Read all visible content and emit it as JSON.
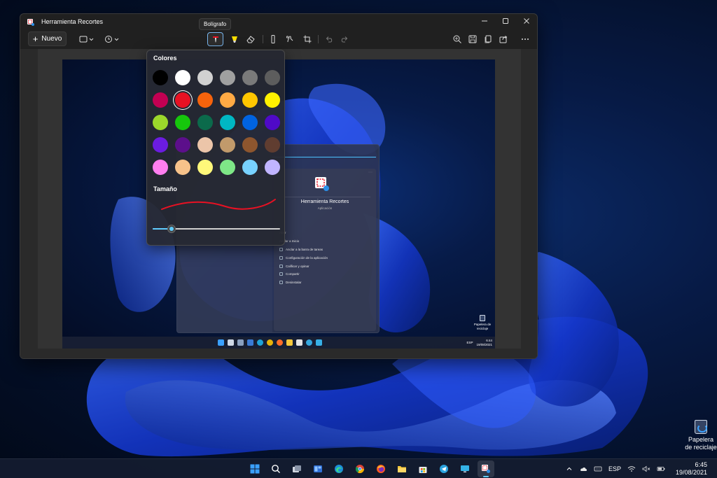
{
  "window": {
    "title": "Herramienta Recortes",
    "controls": [
      "minimize-icon",
      "maximize-icon",
      "close-icon"
    ]
  },
  "toolbar": {
    "new_label": "Nuevo",
    "tooltip": "Bolígrafo",
    "tools": [
      "snip-mode-icon",
      "delay-icon",
      "ballpoint-pen-icon",
      "highlighter-icon",
      "eraser-icon",
      "ruler-icon",
      "touch-writing-icon",
      "crop-icon",
      "undo-icon",
      "redo-icon",
      "zoom-icon",
      "save-icon",
      "copy-icon",
      "share-icon",
      "more-icon"
    ]
  },
  "flyout": {
    "colors_heading": "Colores",
    "size_heading": "Tamaño",
    "selected_color": "#e81123",
    "colors": [
      [
        "#000000",
        "#ffffff",
        "#d1d1d1",
        "#a0a0a0",
        "#7a7a7a",
        "#5d5d5d"
      ],
      [
        "#c30052",
        "#e81123",
        "#f7630c",
        "#ffaa44",
        "#ffc600",
        "#fff100"
      ],
      [
        "#9bd72b",
        "#16c60c",
        "#0b6a4b",
        "#00b7c3",
        "#0063e1",
        "#4f0ac8"
      ],
      [
        "#6b1ce0",
        "#5c0f8b",
        "#ecc5a9",
        "#c19a6b",
        "#8e562e",
        "#603d30"
      ],
      [
        "#ff7ef0",
        "#f7c28a",
        "#fff87a",
        "#7ee787",
        "#78d2ff",
        "#c0b4ff"
      ]
    ],
    "size_fraction": 0.15
  },
  "screenshot": {
    "app_name": "Herramienta Recortes",
    "app_type": "Aplicación",
    "menu": [
      "Abrir",
      "Anclar a Inicio",
      "Anclar a la barra de tareas",
      "Configuración de la aplicación",
      "Calificar y opinar",
      "Compartir",
      "Desinstalar"
    ],
    "recycle_bin": "Papelera de reciclaje",
    "lang": "ESP",
    "time": "6:44",
    "date": "19/08/2021"
  },
  "desktop": {
    "recycle_bin": "Papelera de reciclaje"
  },
  "taskbar": {
    "lang": "ESP",
    "time": "6:45",
    "date": "19/08/2021",
    "apps": [
      "start-icon",
      "search-icon",
      "task-view-icon",
      "widgets-icon",
      "edge-icon",
      "chrome-icon",
      "firefox-icon",
      "file-explorer-icon",
      "store-icon",
      "telegram-icon",
      "remote-desktop-icon",
      "snipping-tool-icon"
    ]
  },
  "colors": {
    "accent": "#60cdff",
    "window_bg": "#202020"
  }
}
